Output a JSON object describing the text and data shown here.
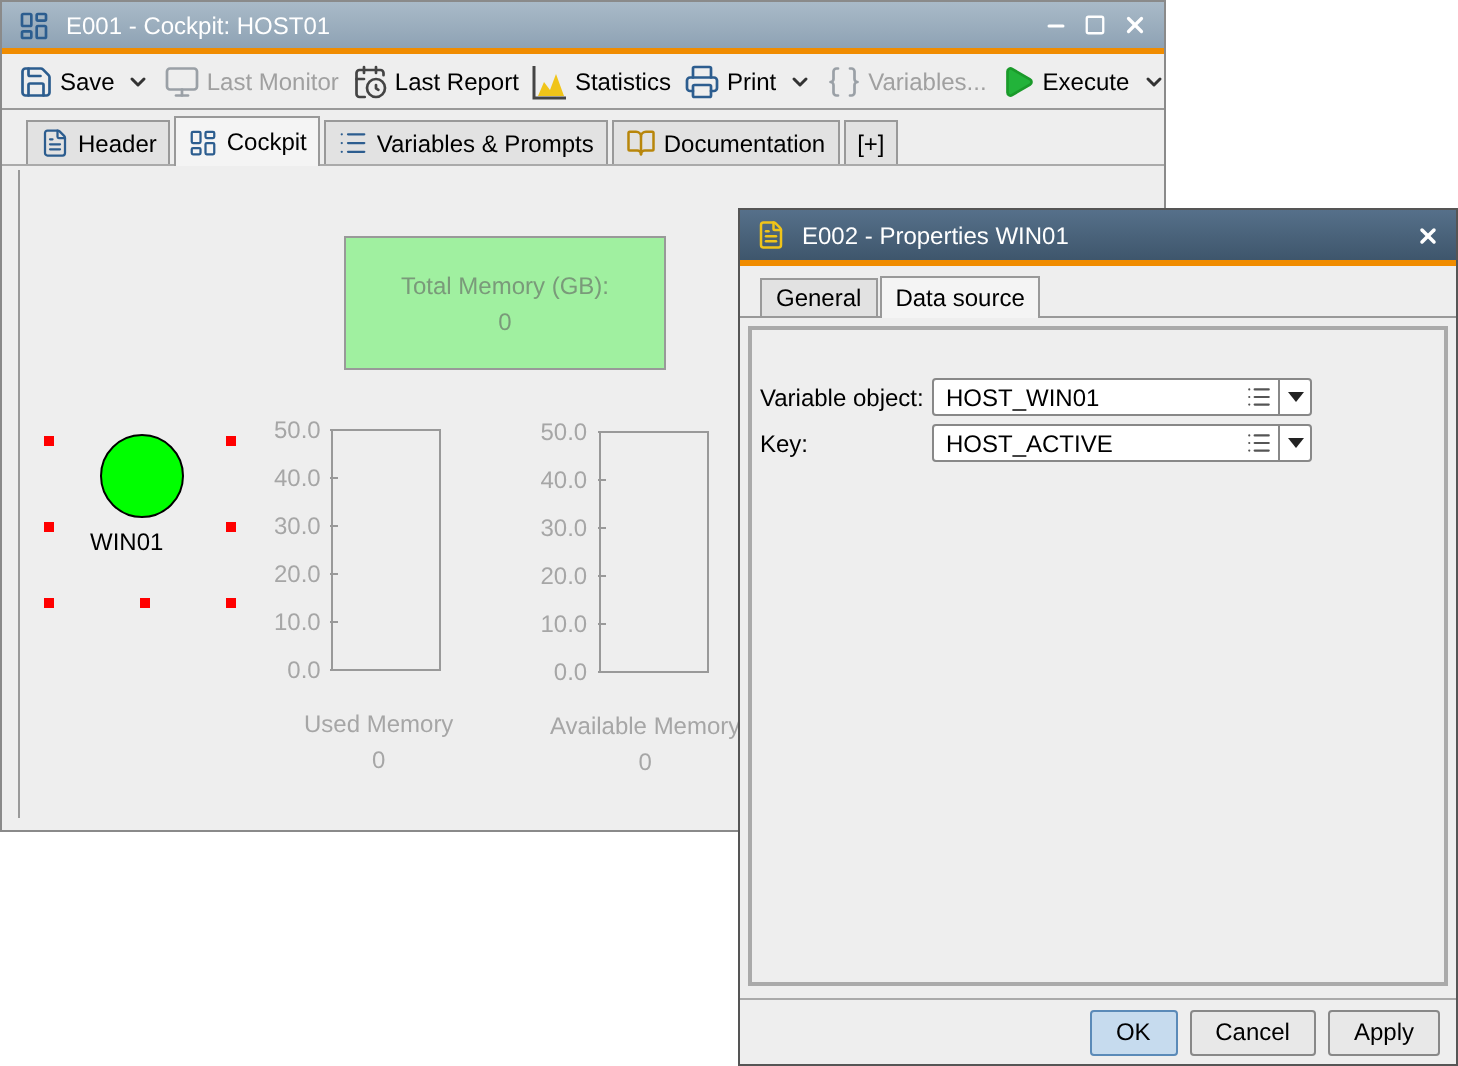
{
  "main_window": {
    "title": "E001 - Cockpit: HOST01"
  },
  "toolbar": [
    {
      "label": "Save",
      "kind": "save",
      "disabled": false,
      "dropdown": true
    },
    {
      "label": "Last Monitor",
      "kind": "monitor",
      "disabled": true,
      "dropdown": false
    },
    {
      "label": "Last Report",
      "kind": "report",
      "disabled": false,
      "dropdown": false
    },
    {
      "label": "Statistics",
      "kind": "stats",
      "disabled": false,
      "dropdown": false
    },
    {
      "label": "Print",
      "kind": "print",
      "disabled": false,
      "dropdown": true
    },
    {
      "label": "Variables...",
      "kind": "vars",
      "disabled": true,
      "dropdown": false
    },
    {
      "label": "Execute",
      "kind": "exec",
      "disabled": false,
      "dropdown": true
    }
  ],
  "tabs": [
    {
      "label": "Header",
      "kind": "header",
      "selected": false
    },
    {
      "label": "Cockpit",
      "kind": "cockpit",
      "selected": true
    },
    {
      "label": "Variables & Prompts",
      "kind": "vars",
      "selected": false
    },
    {
      "label": "Documentation",
      "kind": "doc",
      "selected": false
    },
    {
      "label": "[+]",
      "kind": "add",
      "selected": false
    }
  ],
  "cockpit": {
    "total_memory": {
      "label": "Total Memory (GB):",
      "value": "0"
    },
    "host": {
      "label": "WIN01",
      "color": "#00ff00",
      "selected": true
    },
    "gauges": [
      {
        "label": "Used Memory",
        "reading": "0",
        "ticks": [
          "50.0",
          "40.0",
          "30.0",
          "20.0",
          "10.0",
          "0.0"
        ]
      },
      {
        "label": "Available Memory",
        "reading": "0",
        "ticks": [
          "50.0",
          "40.0",
          "30.0",
          "20.0",
          "10.0",
          "0.0"
        ]
      }
    ]
  },
  "dialog": {
    "title": "E002 - Properties WIN01",
    "tabs": [
      {
        "label": "General",
        "selected": false
      },
      {
        "label": "Data source",
        "selected": true
      }
    ],
    "fields": [
      {
        "label": "Variable object:",
        "value": "HOST_WIN01"
      },
      {
        "label": "Key:",
        "value": "HOST_ACTIVE"
      }
    ],
    "buttons": [
      {
        "label": "OK",
        "default": true
      },
      {
        "label": "Cancel",
        "default": false
      },
      {
        "label": "Apply",
        "default": false
      }
    ]
  }
}
